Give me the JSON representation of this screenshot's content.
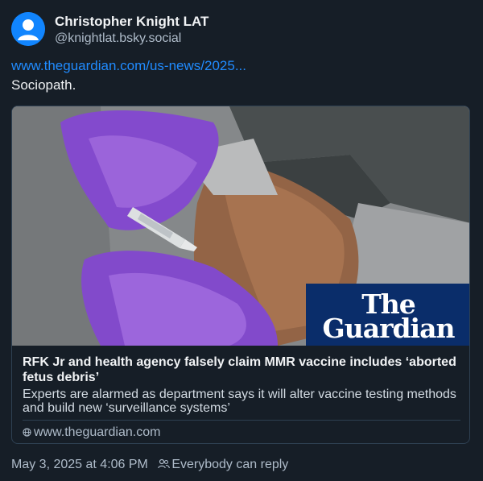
{
  "author": {
    "display_name": "Christopher Knight LAT",
    "handle": "@knightlat.bsky.social",
    "avatar_icon": "default-avatar-icon",
    "avatar_color": "#1185fe"
  },
  "post": {
    "link_text": "www.theguardian.com/us-news/2025...",
    "text": "Sociopath."
  },
  "card": {
    "logo_line1": "The",
    "logo_line2": "Guardian",
    "logo_color": "#0a2d6a",
    "title": "RFK Jr and health agency falsely claim MMR vaccine includes ‘aborted fetus debris’",
    "description": "Experts are alarmed as department says it will alter vaccine testing methods and build new ‘surveillance systems’",
    "domain": "www.theguardian.com",
    "domain_icon": "globe-icon"
  },
  "footer": {
    "timestamp": "May 3, 2025 at 4:06 PM",
    "reply_setting": "Everybody can reply",
    "reply_icon": "people-icon"
  },
  "colors": {
    "background": "#161e27",
    "link": "#208bfe",
    "muted": "#aebbc9",
    "border": "#2e4052"
  }
}
